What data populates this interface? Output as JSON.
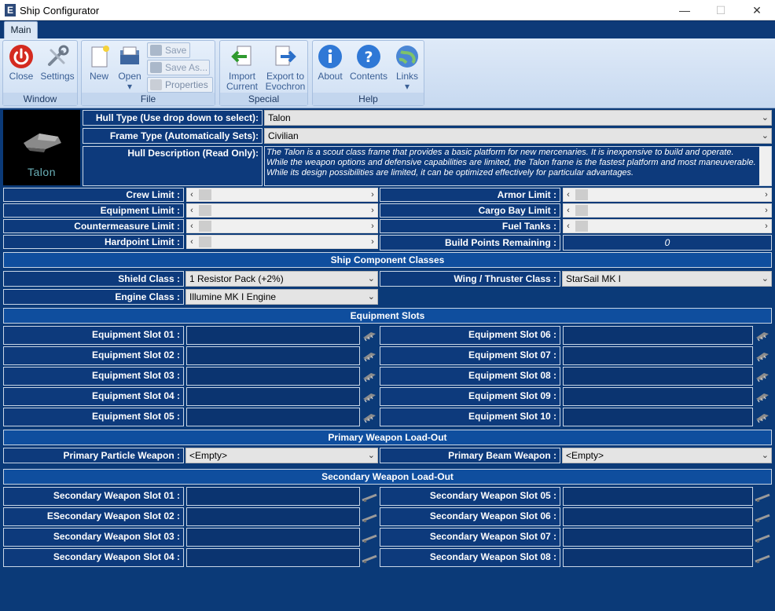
{
  "window": {
    "title": "Ship Configurator",
    "app_icon": "E",
    "minimize": "—",
    "maximize": "☐",
    "close": "✕"
  },
  "ribbon": {
    "tabs": [
      {
        "label": "Main"
      }
    ],
    "groups": {
      "window": "Window",
      "file": "File",
      "special": "Special",
      "help": "Help"
    },
    "buttons": {
      "close": "Close",
      "settings": "Settings",
      "new": "New",
      "open": "Open",
      "save": "Save",
      "save_as": "Save As...",
      "properties": "Properties",
      "import_current": "Import Current",
      "export_evochron": "Export to Evochron",
      "about": "About",
      "contents": "Contents",
      "links": "Links"
    }
  },
  "hull": {
    "image_caption": "Talon",
    "type_label": "Hull Type (Use drop down to select):",
    "type_value": "Talon",
    "frame_label": "Frame Type (Automatically Sets):",
    "frame_value": "Civilian",
    "desc_label": "Hull Description (Read Only):",
    "description": "The Talon is a scout class frame that provides a basic platform for new mercenaries. It is inexpensive to build and operate. While the weapon options and defensive capabilities are limited, the Talon frame is the fastest platform and most maneuverable. While its design possibilities are limited, it can be optimized effectively for particular advantages."
  },
  "limits": {
    "left": [
      "Crew Limit :",
      "Equipment Limit :",
      "Countermeasure Limit :",
      "Hardpoint Limit :"
    ],
    "right": [
      "Armor Limit :",
      "Cargo Bay Limit :",
      "Fuel Tanks :"
    ],
    "build_points_label": "Build Points Remaining :",
    "build_points_value": "0"
  },
  "component_classes": {
    "header": "Ship Component Classes",
    "shield_label": "Shield Class :",
    "shield_value": "1 Resistor Pack (+2%)",
    "wing_label": "Wing / Thruster Class :",
    "wing_value": "StarSail MK I",
    "engine_label": "Engine Class :",
    "engine_value": "Illumine MK I Engine"
  },
  "equipment": {
    "header": "Equipment Slots",
    "left": [
      "Equipment Slot 01 :",
      "Equipment Slot 02 :",
      "Equipment Slot 03 :",
      "Equipment Slot 04 :",
      "Equipment Slot 05 :"
    ],
    "right": [
      "Equipment Slot 06 :",
      "Equipment Slot 07 :",
      "Equipment Slot 08 :",
      "Equipment Slot 09 :",
      "Equipment Slot 10 :"
    ]
  },
  "primary": {
    "header": "Primary Weapon Load-Out",
    "particle_label": "Primary Particle Weapon :",
    "particle_value": "<Empty>",
    "beam_label": "Primary Beam Weapon :",
    "beam_value": "<Empty>"
  },
  "secondary": {
    "header": "Secondary Weapon Load-Out",
    "left": [
      "Secondary Weapon Slot 01 :",
      "ESecondary Weapon Slot 02 :",
      "Secondary Weapon Slot 03 :",
      "Secondary Weapon Slot 04 :"
    ],
    "right": [
      "Secondary Weapon Slot 05 :",
      "Secondary Weapon Slot 06 :",
      "Secondary Weapon Slot 07 :",
      "Secondary Weapon Slot 08 :"
    ]
  }
}
